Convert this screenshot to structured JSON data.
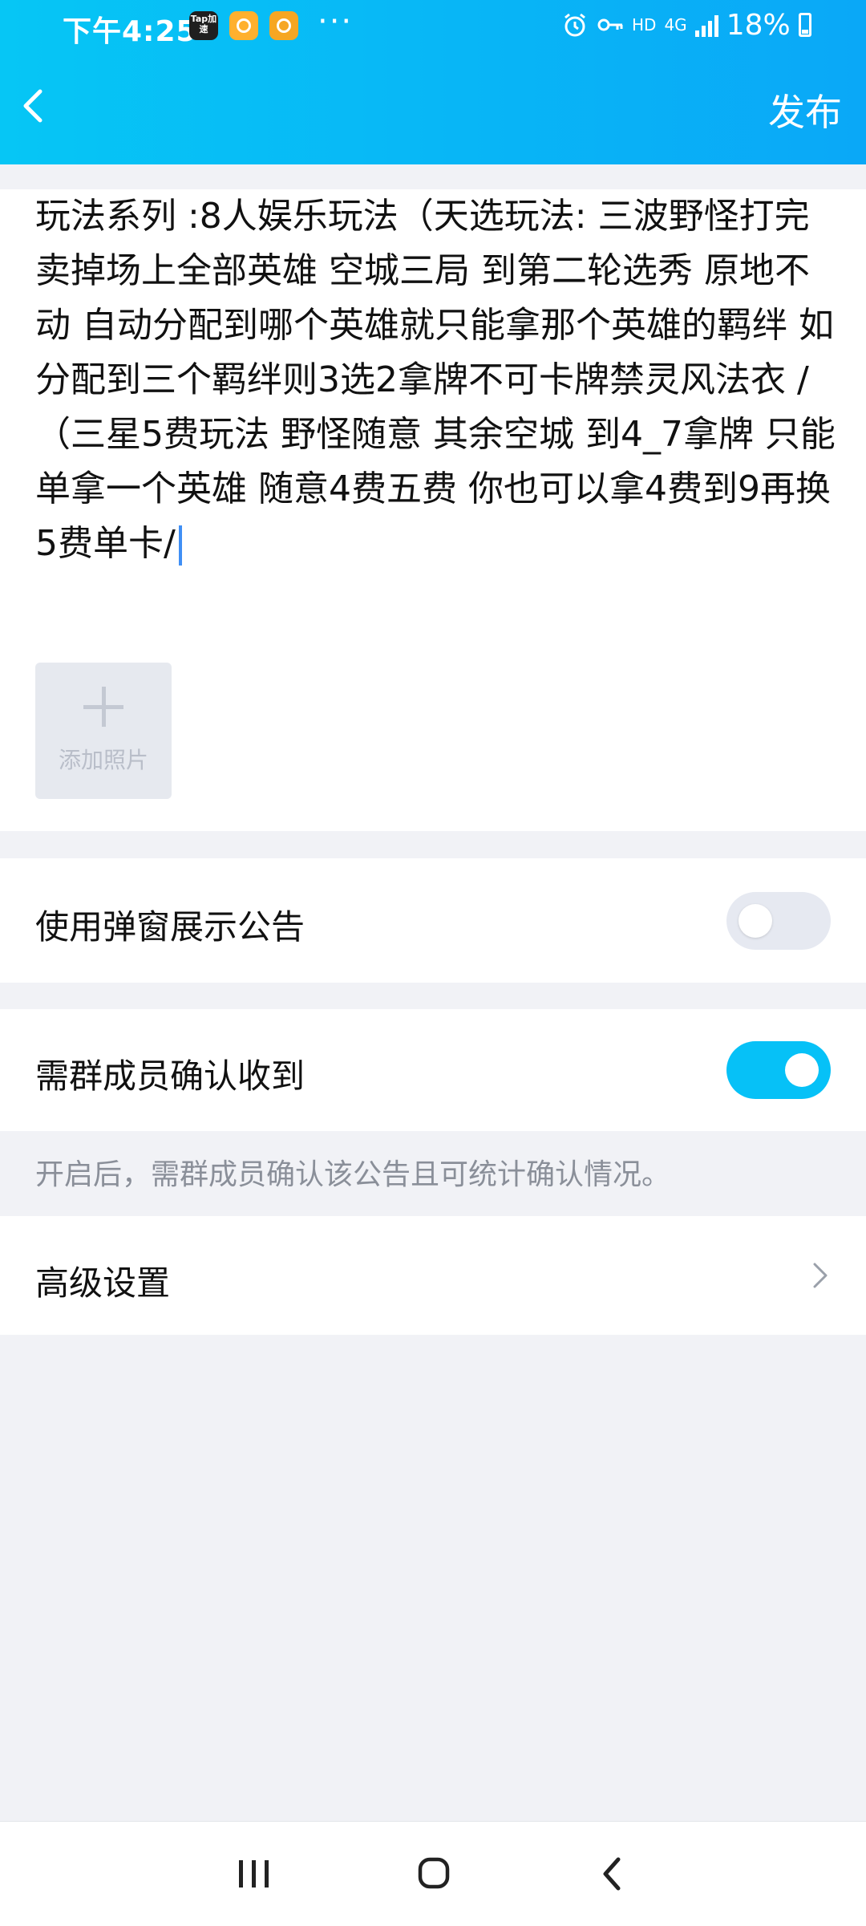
{
  "status_bar": {
    "time": "下午4:25",
    "tap_icon_text": "Tap加速",
    "more": "···",
    "hd": "HD",
    "network": "4G",
    "battery": "18%"
  },
  "title_bar": {
    "publish_label": "发布"
  },
  "editor": {
    "content": "玩法系列 :8人娱乐玩法（天选玩法: 三波野怪打完卖掉场上全部英雄 空城三局 到第二轮选秀 原地不动 自动分配到哪个英雄就只能拿那个英雄的羁绊 如分配到三个羁绊则3选2拿牌不可卡牌禁灵风法衣 /\n（三星5费玩法 野怪随意 其余空城 到4_7拿牌 只能单拿一个英雄 随意4费五费 你也可以拿4费到9再换5费单卡/",
    "add_photo_label": "添加照片"
  },
  "settings": {
    "popup_label": "使用弹窗展示公告",
    "popup_enabled": false,
    "confirm_label": "需群成员确认收到",
    "confirm_enabled": true,
    "confirm_hint": "开启后，需群成员确认该公告且可统计确认情况。",
    "advanced_label": "高级设置"
  },
  "colors": {
    "accent": "#06c1f7",
    "header_start": "#06c6f5",
    "header_end": "#0aa8f7"
  },
  "icons": {
    "back": "chevron-left-icon",
    "advanced": "chevron-right-icon",
    "add_photo": "plus-icon",
    "nav_recents": "recents-icon",
    "nav_home": "home-icon",
    "nav_back": "back-icon"
  }
}
